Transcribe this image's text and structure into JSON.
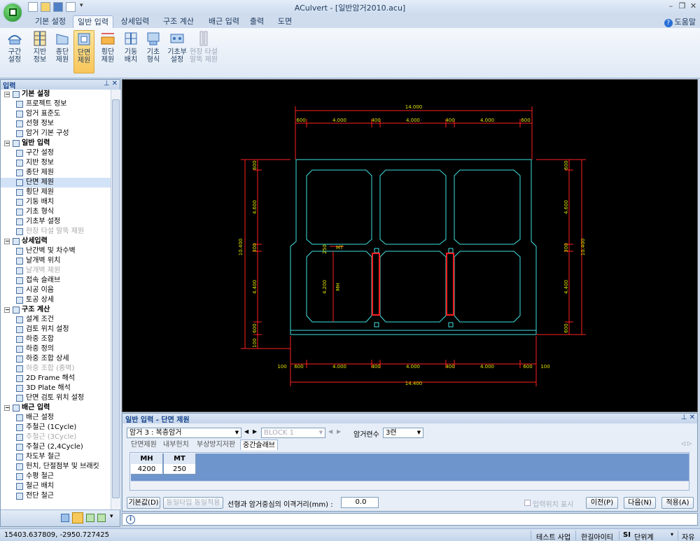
{
  "window": {
    "title": "ACulvert - [일반암거2010.acu]"
  },
  "ribbon_tabs": [
    "기본 설정",
    "일반 입력",
    "상세입력",
    "구조 계산",
    "배근 입력",
    "출력",
    "도면"
  ],
  "help_label": "도움말",
  "ribbon_buttons": [
    {
      "label": "구간\n설정"
    },
    {
      "label": "지반\n정보"
    },
    {
      "label": "종단\n제원"
    },
    {
      "label": "단면\n제원",
      "active": true
    },
    {
      "label": "횡단\n제원"
    },
    {
      "label": "기둥\n배치"
    },
    {
      "label": "기초\n형식"
    },
    {
      "label": "기초부\n설정"
    },
    {
      "label": "현장 타설\n말뚝 제원",
      "disabled": true
    }
  ],
  "left_panel": {
    "title": "입력",
    "tree": [
      {
        "g": "기본 설정"
      },
      {
        "t": "프로젝트 정보"
      },
      {
        "t": "암거 표준도"
      },
      {
        "t": "선형 정보"
      },
      {
        "t": "암거 기본 구성"
      },
      {
        "g": "일반 입력"
      },
      {
        "t": "구간 설정"
      },
      {
        "t": "지반 정보"
      },
      {
        "t": "종단 제원"
      },
      {
        "t": "단면 제원",
        "sel": true
      },
      {
        "t": "횡단 제원"
      },
      {
        "t": "기둥 배치"
      },
      {
        "t": "기초 형식"
      },
      {
        "t": "기초부 설정"
      },
      {
        "t": "현장 타설 말뚝 제원",
        "dis": true
      },
      {
        "g": "상세입력"
      },
      {
        "t": "난간벽 및 차수벽"
      },
      {
        "t": "날개벽 위치"
      },
      {
        "t": "날개벽 제원",
        "dis": true
      },
      {
        "t": "접속 슬래브"
      },
      {
        "t": "시공 이음"
      },
      {
        "t": "토공 상세"
      },
      {
        "g": "구조 계산"
      },
      {
        "t": "설계 조건"
      },
      {
        "t": "검토 위치 설정"
      },
      {
        "t": "하중 조합"
      },
      {
        "t": "하중 정의"
      },
      {
        "t": "하중 조합 상세"
      },
      {
        "t": "하중 조합 (종벽)",
        "dis": true
      },
      {
        "t": "2D Frame 해석"
      },
      {
        "t": "3D Plate 해석"
      },
      {
        "t": "단면 검토 위치 설정"
      },
      {
        "g": "배근 입력"
      },
      {
        "t": "배근 설정"
      },
      {
        "t": "주철근 (1Cycle)"
      },
      {
        "t": "주철근 (3Cycle)",
        "dis": true
      },
      {
        "t": "주철근 (2,4Cycle)"
      },
      {
        "t": "차도부 철근"
      },
      {
        "t": "헌치, 단절점부 및 브래킷"
      },
      {
        "t": "수평 철근"
      },
      {
        "t": "철근 배치"
      },
      {
        "t": "전단 철근"
      }
    ]
  },
  "drawing": {
    "dims": {
      "top_total": "14.000",
      "top_parts": [
        "600",
        "4.000",
        "400",
        "4.000",
        "400",
        "4.000",
        "600"
      ],
      "bottom_total": "14.400",
      "bottom_parts": [
        "100",
        "600",
        "4.000",
        "400",
        "4.000",
        "400",
        "4.000",
        "600",
        "100"
      ],
      "left_total": "10.400",
      "left_parts": [
        "600",
        "4.600",
        "300",
        "4.400",
        "600",
        "100"
      ],
      "right_total": "10.400",
      "right_parts": [
        "600",
        "4.600",
        "300",
        "4.400",
        "600"
      ],
      "inner_h": "4.200",
      "inner_mh": "MH",
      "inner_mt": "MT",
      "inner_250": "250"
    }
  },
  "bottom_panel": {
    "title": "일반 입력 - 단면 제원",
    "culvert_select": "암거 3 : 복층암거",
    "block_select": "BLOCK 1",
    "culvert_count_label": "암거련수",
    "culvert_count": "3련",
    "subtabs": [
      "단면제원",
      "내부헌치",
      "부상방지저판",
      "중간슬래브"
    ],
    "grid_headers": [
      "MH",
      "MT"
    ],
    "grid_values": [
      "4200",
      "250"
    ],
    "default_btn": "기본값(D)",
    "same_type_btn": "동일타입 동일적용",
    "offset_label": "선형과 암거중심의 이격거리(mm) :",
    "offset_value": "0.0",
    "show_pos_label": "입력위치 표시",
    "prev_btn": "이전(P)",
    "next_btn": "다음(N)",
    "apply_btn": "적용(A)"
  },
  "status_bar": {
    "coords": "15403.637809,   -2950.727425",
    "company1": "테스트 사업",
    "company2": "한길아이티",
    "unit_prefix": "SI",
    "unit": "단위계",
    "mode": "자유"
  },
  "colors": {
    "canvas": "#000000",
    "cyan": "#40e0e0",
    "red": "#ff2020",
    "green": "#30e030",
    "yellow": "#e0e000"
  }
}
